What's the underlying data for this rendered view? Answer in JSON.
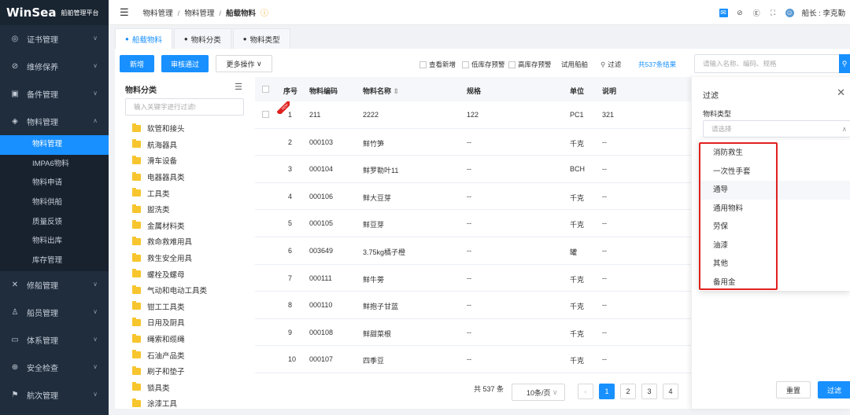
{
  "app": {
    "brand": "WinSea",
    "subtitle": "船舶管理平台"
  },
  "sidebar": {
    "items": [
      {
        "label": "证书管理",
        "icon": "certificate-icon"
      },
      {
        "label": "维修保养",
        "icon": "maintenance-icon"
      },
      {
        "label": "备件管理",
        "icon": "spare-parts-icon"
      },
      {
        "label": "物料管理",
        "icon": "materials-icon"
      }
    ],
    "submenu": [
      "物料管理",
      "IMPA6物料",
      "物料申请",
      "物料供船",
      "质量反馈",
      "物料出库",
      "库存管理"
    ],
    "items_after": [
      {
        "label": "修船管理",
        "icon": "repair-icon"
      },
      {
        "label": "船员管理",
        "icon": "crew-icon"
      },
      {
        "label": "体系管理",
        "icon": "system-icon"
      },
      {
        "label": "安全检查",
        "icon": "safety-icon"
      },
      {
        "label": "航次管理",
        "icon": "voyage-icon"
      }
    ]
  },
  "header": {
    "breadcrumb": [
      "物料管理",
      "物料管理",
      "船载物料"
    ],
    "user": "船长 : 李克勤"
  },
  "tabs": [
    "船载物料",
    "物料分类",
    "物料类型"
  ],
  "toolbar": {
    "add": "新增",
    "approve": "审核通过",
    "more": "更多操作",
    "check_new": "查看新增",
    "low_stock": "低库存预警",
    "high_stock": "高库存预警",
    "ship_use": "试用船舶",
    "filter": "过滤",
    "result_count": "共537条结果",
    "search_placeholder": "请输入名称、编码、规格"
  },
  "category_panel": {
    "title": "物料分类",
    "search_placeholder": "输入关键字进行过滤!",
    "items": [
      "软管和接头",
      "航海器具",
      "滑车设备",
      "电器器具类",
      "工具类",
      "盥洗类",
      "金属材料类",
      "救命救难用具",
      "救生安全用具",
      "螺栓及螺母",
      "气动和电动工具类",
      "钳工工具类",
      "日用及厨具",
      "绳索和缆绳",
      "石油产品类",
      "刷子和垫子",
      "锁具类",
      "涂漆工具"
    ]
  },
  "table": {
    "headers": {
      "index": "序号",
      "code": "物料编码",
      "name": "物料名称",
      "spec": "规格",
      "unit": "单位",
      "desc": "说明"
    },
    "rows": [
      {
        "index": "1",
        "code": "211",
        "name": "2222",
        "spec": "122",
        "unit": "PC1",
        "desc": "321",
        "new_badge": "NEW"
      },
      {
        "index": "2",
        "code": "000103",
        "name": "鲜竹笋",
        "spec": "--",
        "unit": "千克",
        "desc": "--"
      },
      {
        "index": "3",
        "code": "000104",
        "name": "鲜罗勒叶11",
        "spec": "--",
        "unit": "BCH",
        "desc": "--"
      },
      {
        "index": "4",
        "code": "000106",
        "name": "鲜大豆芽",
        "spec": "--",
        "unit": "千克",
        "desc": "--"
      },
      {
        "index": "5",
        "code": "000105",
        "name": "鲜豆芽",
        "spec": "--",
        "unit": "千克",
        "desc": "--"
      },
      {
        "index": "6",
        "code": "003649",
        "name": "3.75kg橘子橙",
        "spec": "--",
        "unit": "罐",
        "desc": "--"
      },
      {
        "index": "7",
        "code": "000111",
        "name": "鲜牛蒡",
        "spec": "--",
        "unit": "千克",
        "desc": "--"
      },
      {
        "index": "8",
        "code": "000110",
        "name": "鲜抱子甘蓝",
        "spec": "--",
        "unit": "千克",
        "desc": "--"
      },
      {
        "index": "9",
        "code": "000108",
        "name": "鲜甜菜根",
        "spec": "--",
        "unit": "千克",
        "desc": "--"
      },
      {
        "index": "10",
        "code": "000107",
        "name": "四季豆",
        "spec": "--",
        "unit": "千克",
        "desc": "--"
      }
    ]
  },
  "pagination": {
    "total": "共 537 条",
    "page_size": "10条/页",
    "pages": [
      "1",
      "2",
      "3",
      "4"
    ],
    "current": "1"
  },
  "filter_panel": {
    "title": "过滤",
    "field_label": "物料类型",
    "select_placeholder": "请选择",
    "options": [
      "消防救生",
      "一次性手套",
      "通导",
      "通用物料",
      "劳保",
      "油漆",
      "其他",
      "备用金"
    ],
    "reset": "重置",
    "apply": "过滤"
  },
  "colors": {
    "sidebar_bg": "#1f2d3d",
    "primary": "#1890ff",
    "highlight": "#e02020"
  }
}
